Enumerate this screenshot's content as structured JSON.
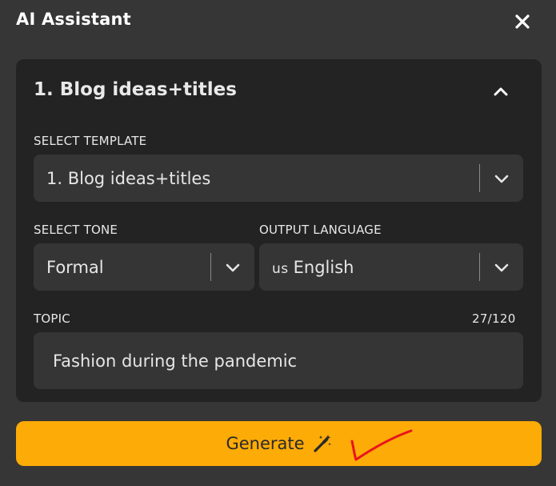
{
  "header": {
    "title": "AI Assistant",
    "close_icon": "close-icon"
  },
  "panel": {
    "title": "1. Blog ideas+titles",
    "collapse_icon": "chevron-up-icon",
    "template": {
      "label": "SELECT TEMPLATE",
      "value": "1. Blog ideas+titles"
    },
    "tone": {
      "label": "SELECT TONE",
      "value": "Formal"
    },
    "language": {
      "label": "OUTPUT LANGUAGE",
      "flag": "us",
      "value": "English"
    },
    "topic": {
      "label": "TOPIC",
      "counter": "27/120",
      "value": "Fashion during the pandemic"
    }
  },
  "generate": {
    "label": "Generate",
    "icon": "magic-wand-icon",
    "color": "#fdab06"
  },
  "annotation": {
    "icon": "red-checkmark-icon",
    "color": "#e8141c"
  }
}
